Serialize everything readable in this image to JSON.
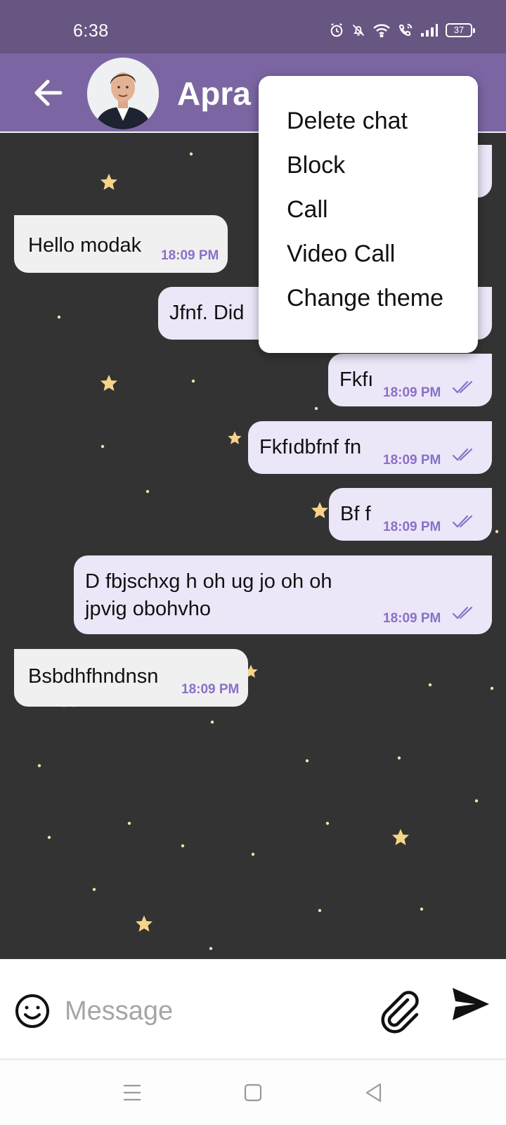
{
  "status_bar": {
    "time": "6:38",
    "battery": "37",
    "icons": [
      "alarm-icon",
      "mute-notifications-icon",
      "wifi-icon",
      "wifi-calling-icon",
      "signal-icon",
      "battery-icon"
    ]
  },
  "header": {
    "contact_name": "Apra",
    "back_icon": "arrow-left-icon",
    "avatar": "contact-avatar"
  },
  "messages": [
    {
      "direction": "out",
      "text": "",
      "time": ""
    },
    {
      "direction": "in",
      "text": "Hello modak",
      "time": "18:09 PM"
    },
    {
      "direction": "out",
      "text": "Jfnf. Did",
      "time": ""
    },
    {
      "direction": "out",
      "text": "Fkfı",
      "time": "18:09 PM",
      "read": true
    },
    {
      "direction": "out",
      "text": "Fkfıdbfnf fn",
      "time": "18:09 PM",
      "read": true
    },
    {
      "direction": "out",
      "text": "Bf f",
      "time": "18:09 PM",
      "read": true
    },
    {
      "direction": "out",
      "text_line1": "D fbjschxg h oh ug jo oh oh",
      "text_line2": "jpvig obohvho",
      "time": "18:09 PM",
      "read": true
    },
    {
      "direction": "in",
      "text": "Bsbdhfhndnsn",
      "time": "18:09 PM"
    }
  ],
  "menu": {
    "items": [
      "Delete chat",
      "Block",
      "Call",
      "Video Call",
      "Change theme"
    ]
  },
  "composer": {
    "placeholder": "Message",
    "emoji_icon": "smiley-icon",
    "attach_icon": "paperclip-icon",
    "send_icon": "send-icon"
  },
  "nav": {
    "icons": [
      "menu-lines-icon",
      "home-square-icon",
      "back-triangle-icon"
    ]
  },
  "colors": {
    "status_bar": "#675582",
    "app_bar": "#7b66a3",
    "chat_background": "#333333",
    "incoming_bubble": "#f0f0f0",
    "outgoing_bubble": "#ece7f8",
    "timestamp": "#8a70c8",
    "star": "#f7d38a"
  }
}
